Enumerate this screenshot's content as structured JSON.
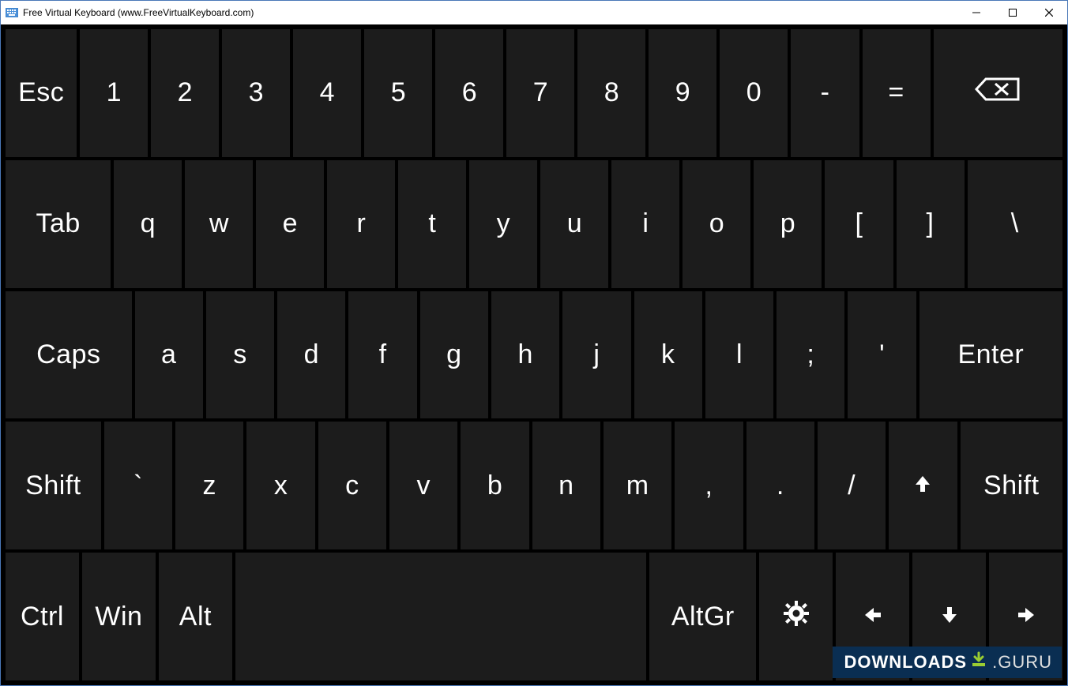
{
  "window": {
    "title": "Free Virtual Keyboard (www.FreeVirtualKeyboard.com)"
  },
  "row1": {
    "esc": "Esc",
    "k1": "1",
    "k2": "2",
    "k3": "3",
    "k4": "4",
    "k5": "5",
    "k6": "6",
    "k7": "7",
    "k8": "8",
    "k9": "9",
    "k0": "0",
    "minus": "-",
    "equals": "="
  },
  "row2": {
    "tab": "Tab",
    "q": "q",
    "w": "w",
    "e": "e",
    "r": "r",
    "t": "t",
    "y": "y",
    "u": "u",
    "i": "i",
    "o": "o",
    "p": "p",
    "lbracket": "[",
    "rbracket": "]",
    "backslash": "\\"
  },
  "row3": {
    "caps": "Caps",
    "a": "a",
    "s": "s",
    "d": "d",
    "f": "f",
    "g": "g",
    "h": "h",
    "j": "j",
    "k": "k",
    "l": "l",
    "semicolon": ";",
    "quote": "'",
    "enter": "Enter"
  },
  "row4": {
    "lshift": "Shift",
    "grave": "`",
    "z": "z",
    "x": "x",
    "c": "c",
    "v": "v",
    "b": "b",
    "n": "n",
    "m": "m",
    "comma": ",",
    "period": ".",
    "slash": "/",
    "rshift": "Shift"
  },
  "row5": {
    "ctrl": "Ctrl",
    "win": "Win",
    "alt": "Alt",
    "altgr": "AltGr"
  },
  "watermark": {
    "left": "DOWNLOADS",
    "right": ".GURU"
  }
}
